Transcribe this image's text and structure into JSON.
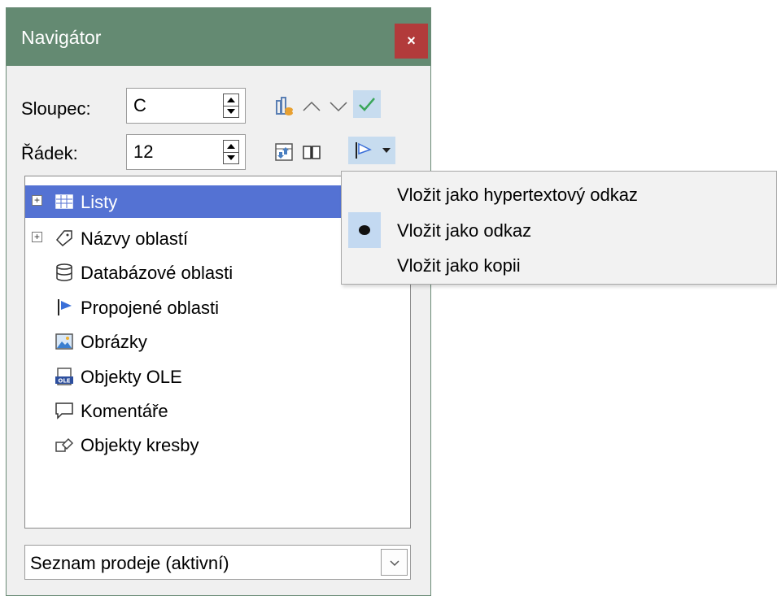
{
  "window": {
    "title": "Navigátor",
    "close_glyph": "×"
  },
  "column": {
    "label": "Sloupec:",
    "value": "C"
  },
  "row": {
    "label": "Řádek:",
    "value": "12"
  },
  "toolbar": {
    "icons": [
      "toggle-icon",
      "up-icon",
      "down-icon",
      "checkmark-icon",
      "content-view-icon",
      "book-icon",
      "drag-mode-flag-icon",
      "dropdown-arrow-icon"
    ]
  },
  "tree": {
    "items": [
      {
        "label": "Listy",
        "icon": "sheets-icon",
        "expandable": true,
        "selected": true
      },
      {
        "label": "Názvy oblastí",
        "icon": "tag-icon",
        "expandable": true,
        "selected": false
      },
      {
        "label": "Databázové oblasti",
        "icon": "database-icon",
        "expandable": false
      },
      {
        "label": "Propojené oblasti",
        "icon": "flag-icon",
        "expandable": false
      },
      {
        "label": "Obrázky",
        "icon": "image-icon",
        "expandable": false
      },
      {
        "label": "Objekty OLE",
        "icon": "ole-icon",
        "expandable": false
      },
      {
        "label": "Komentáře",
        "icon": "comment-icon",
        "expandable": false
      },
      {
        "label": "Objekty kresby",
        "icon": "drawing-icon",
        "expandable": false
      }
    ]
  },
  "document_selector": {
    "value": "Seznam prodeje (aktivní)"
  },
  "drag_mode_menu": {
    "items": [
      {
        "label": "Vložit jako hypertextový odkaz",
        "checked": false
      },
      {
        "label": "Vložit jako odkaz",
        "checked": true
      },
      {
        "label": "Vložit jako kopii",
        "checked": false
      }
    ]
  },
  "colors": {
    "titlebar": "#648a72",
    "close": "#b23b3b",
    "selection": "#5472d3",
    "check_green": "#3aa65a"
  }
}
